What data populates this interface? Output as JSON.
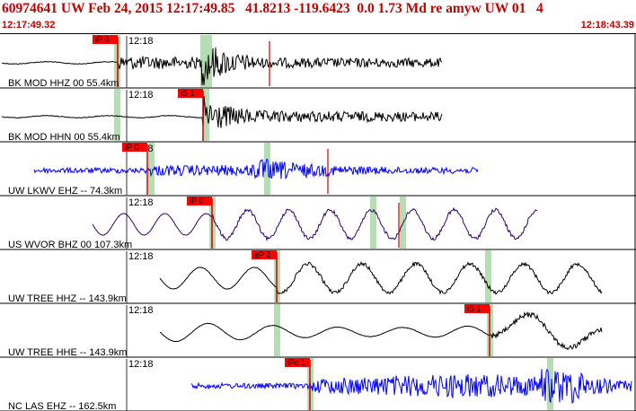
{
  "header": {
    "title": "60974641 UW Feb 24, 2015 12:17:49.85   41.8213 -119.6423  0.0 1.73 Md re amyw UW 01   4",
    "start_time": "12:17:49.32",
    "end_time": "12:18:43.39"
  },
  "colors": {
    "header_text": "#c00000",
    "trace_black": "#000000",
    "trace_blue": "#0000ff",
    "trace_purple": "#330066",
    "pick_box": "#ff0000",
    "pick_line": "#cc0000",
    "highlight_band": "#a8d8a8"
  },
  "time_tick_label": "12:18",
  "panels": [
    {
      "id": "p1",
      "label": "BK MOD HHZ 00 55.4km",
      "trace": "black",
      "pick": "iP 0",
      "pick_pos": 0.18
    },
    {
      "id": "p2",
      "label": "BK MOD HHN 00 55.4km",
      "trace": "black",
      "pick": "iS 1",
      "pick_pos": 0.32
    },
    {
      "id": "p3",
      "label": "UW LKWV EHZ -- 74.3km",
      "trace": "blue",
      "pick": "iP 0",
      "pick_pos": 0.23
    },
    {
      "id": "p4",
      "label": "US WVOR BHZ 00 107.3km",
      "trace": "purple",
      "pick": "iP 0",
      "pick_pos": 0.33
    },
    {
      "id": "p5",
      "label": "UW TREE HHZ -- 143.9km",
      "trace": "black",
      "pick": "eP 2",
      "pick_pos": 0.43
    },
    {
      "id": "p6",
      "label": "UW TREE HHE -- 143.9km",
      "trace": "black",
      "pick": "iS 1",
      "pick_pos": 0.77
    },
    {
      "id": "p7",
      "label": "NC LAS EHZ -- 162.5km",
      "trace": "blue",
      "pick": "iPc 1",
      "pick_pos": 0.49
    }
  ]
}
